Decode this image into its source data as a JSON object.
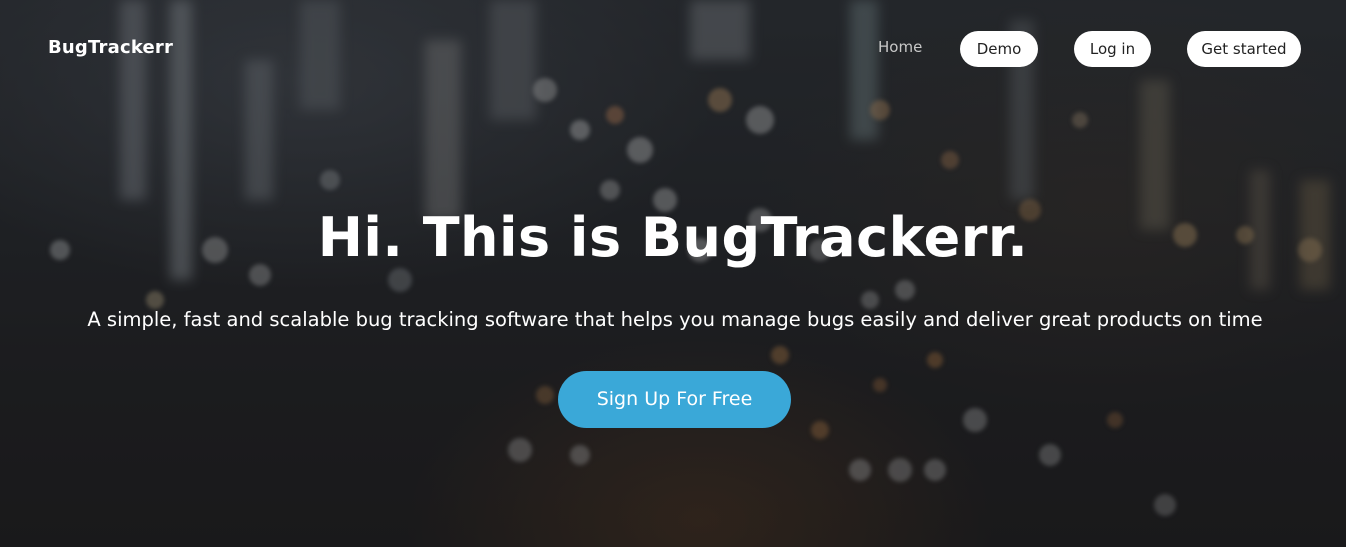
{
  "navbar": {
    "brand": "BugTrackerr",
    "links": {
      "home": "Home",
      "demo": "Demo",
      "login": "Log in",
      "get_started": "Get started"
    }
  },
  "hero": {
    "headline": "Hi. This is BugTrackerr.",
    "subtitle": "A simple, fast and scalable bug tracking software that helps you manage bugs easily and deliver great products on time",
    "cta_label": "Sign Up For Free"
  },
  "colors": {
    "cta_background": "#3aa8d8",
    "pill_background": "#ffffff",
    "hero_background": "#25272b"
  }
}
